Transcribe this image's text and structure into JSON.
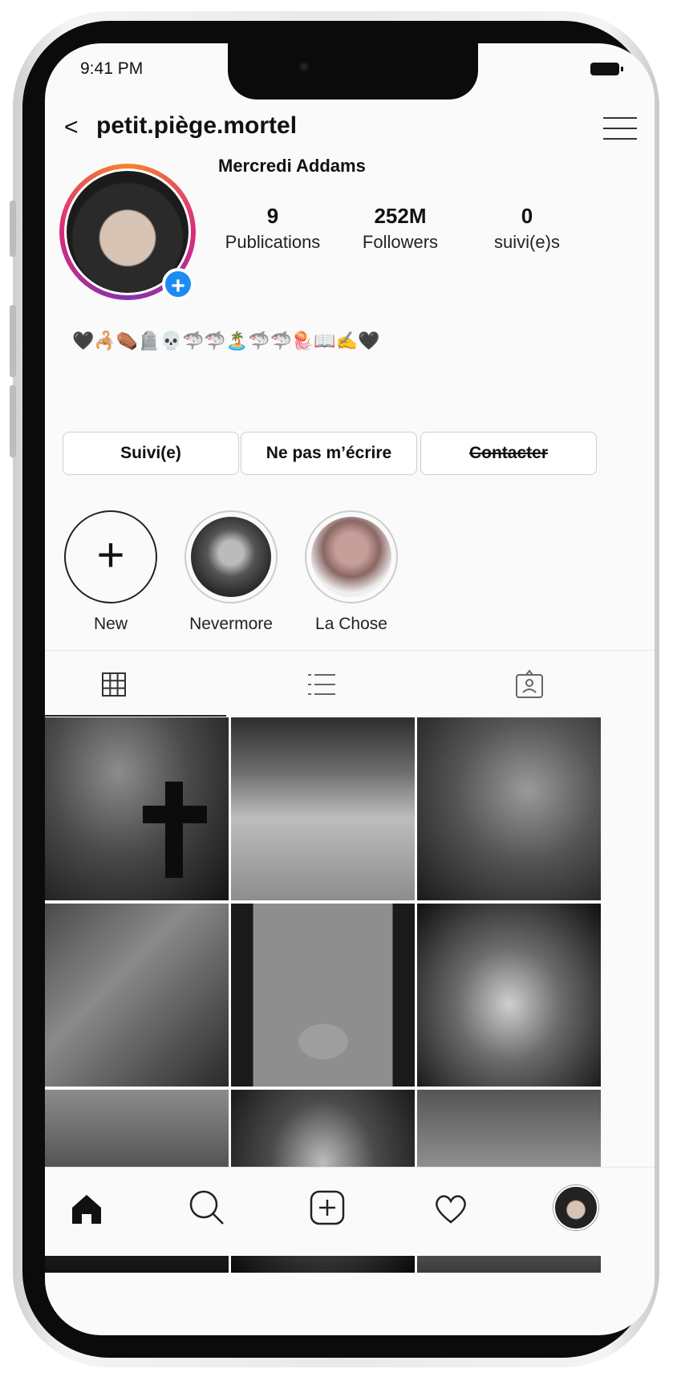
{
  "status_bar": {
    "time": "9:41 PM"
  },
  "header": {
    "back_label": "<",
    "username": "petit.piège.mortel"
  },
  "profile": {
    "full_name": "Mercredi Addams",
    "stats": [
      {
        "value": "9",
        "label": "Publications"
      },
      {
        "value": "252M",
        "label": "Followers"
      },
      {
        "value": "0",
        "label": "suivi(e)s"
      }
    ],
    "bio": "🖤🦂⚰️🪦💀🦈🦈🏝️🦈🦈🪼📖✍️🖤"
  },
  "actions": {
    "follow_label": "Suivi(e)",
    "message_label": "Ne pas m’écrire",
    "contact_label": "Contacter"
  },
  "highlights": [
    {
      "label": "New"
    },
    {
      "label": "Nevermore"
    },
    {
      "label": "La Chose"
    }
  ],
  "tabs": {
    "active": "grid"
  },
  "colors": {
    "accent": "#1d8cf2",
    "background": "#fafafa"
  },
  "icons": [
    "back-icon",
    "menu-icon",
    "add-icon",
    "grid-icon",
    "list-icon",
    "tagged-icon",
    "home-icon",
    "search-icon",
    "new-post-icon",
    "heart-icon"
  ]
}
